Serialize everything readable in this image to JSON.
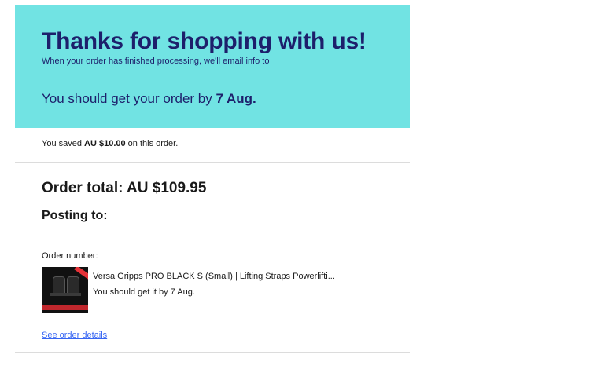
{
  "hero": {
    "title": "Thanks for shopping with us!",
    "subtitle": "When your order has finished processing, we'll email info to",
    "delivery_prefix": "You should get your order by ",
    "delivery_date": "7 Aug."
  },
  "savings": {
    "prefix": "You saved ",
    "amount": "AU $10.00",
    "suffix": " on this order."
  },
  "order": {
    "total_label": "Order total: AU $109.95",
    "posting_label": "Posting to:",
    "number_label": "Order number:",
    "details_link": "See order details"
  },
  "item": {
    "title": "Versa Gripps PRO BLACK S (Small) | Lifting Straps Powerlifti...",
    "eta": "You should get it by 7 Aug.",
    "thumbnail_icon": "product-thumbnail"
  },
  "colors": {
    "hero_bg": "#71e3e3",
    "hero_text": "#1d1f6b",
    "link": "#3665f3",
    "divider": "#dcdcdc"
  }
}
